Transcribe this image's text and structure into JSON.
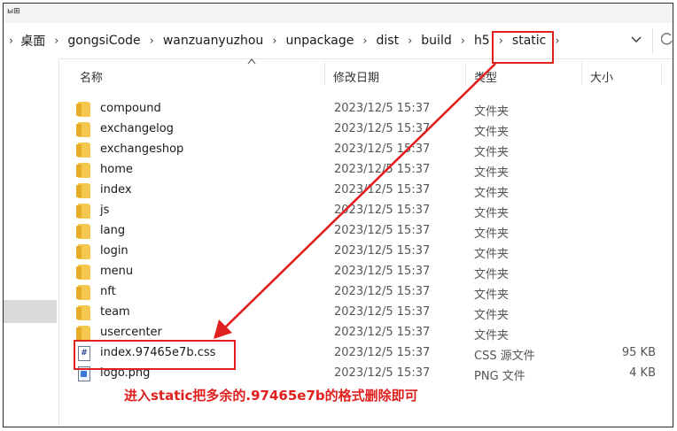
{
  "window": {
    "top_label": "ы⊞"
  },
  "breadcrumb": {
    "items": [
      "桌面",
      "gongsiCode",
      "wanzuanyuzhou",
      "unpackage",
      "dist",
      "build",
      "h5",
      "static"
    ],
    "separator": "›"
  },
  "columns": {
    "name": "名称",
    "date": "修改日期",
    "type": "类型",
    "size": "大小"
  },
  "files": [
    {
      "name": "compound",
      "date": "2023/12/5 15:37",
      "type": "文件夹",
      "size": "",
      "icon": "folder-icon"
    },
    {
      "name": "exchangelog",
      "date": "2023/12/5 15:37",
      "type": "文件夹",
      "size": "",
      "icon": "folder-icon"
    },
    {
      "name": "exchangeshop",
      "date": "2023/12/5 15:37",
      "type": "文件夹",
      "size": "",
      "icon": "folder-icon"
    },
    {
      "name": "home",
      "date": "2023/12/5 15:37",
      "type": "文件夹",
      "size": "",
      "icon": "folder-icon"
    },
    {
      "name": "index",
      "date": "2023/12/5 15:37",
      "type": "文件夹",
      "size": "",
      "icon": "folder-icon"
    },
    {
      "name": "js",
      "date": "2023/12/5 15:37",
      "type": "文件夹",
      "size": "",
      "icon": "folder-icon"
    },
    {
      "name": "lang",
      "date": "2023/12/5 15:37",
      "type": "文件夹",
      "size": "",
      "icon": "folder-icon"
    },
    {
      "name": "login",
      "date": "2023/12/5 15:37",
      "type": "文件夹",
      "size": "",
      "icon": "folder-icon"
    },
    {
      "name": "menu",
      "date": "2023/12/5 15:37",
      "type": "文件夹",
      "size": "",
      "icon": "folder-icon"
    },
    {
      "name": "nft",
      "date": "2023/12/5 15:37",
      "type": "文件夹",
      "size": "",
      "icon": "folder-icon"
    },
    {
      "name": "team",
      "date": "2023/12/5 15:37",
      "type": "文件夹",
      "size": "",
      "icon": "folder-icon"
    },
    {
      "name": "usercenter",
      "date": "2023/12/5 15:37",
      "type": "文件夹",
      "size": "",
      "icon": "folder-icon"
    },
    {
      "name": "index.97465e7b.css",
      "date": "2023/12/5 15:37",
      "type": "CSS 源文件",
      "size": "95 KB",
      "icon": "css-file-icon"
    },
    {
      "name": "logo.png",
      "date": "2023/12/5 15:37",
      "type": "PNG 文件",
      "size": "4 KB",
      "icon": "png-file-icon"
    }
  ],
  "annotation": {
    "caption": "进入static把多余的.97465e7b的格式删除即可",
    "color": "#e0201e"
  },
  "icons": {
    "dropdown": "chevron-down-icon",
    "refresh": "refresh-icon",
    "css_glyph": "#"
  }
}
